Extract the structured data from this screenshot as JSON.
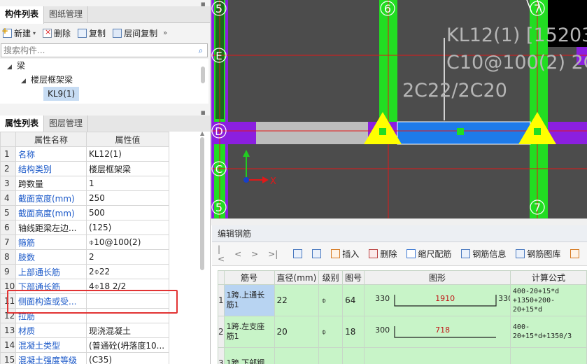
{
  "top_panel": {
    "tabs": [
      {
        "label": "构件列表"
      },
      {
        "label": "图纸管理"
      }
    ],
    "toolbar": {
      "new": "新建",
      "delete": "删除",
      "copy": "复制",
      "layer_copy": "层间复制"
    },
    "search_placeholder": "搜索构件...",
    "tree": {
      "root": "梁",
      "child": "楼层框架梁",
      "item": "KL9(1)"
    }
  },
  "prop_panel": {
    "tabs": [
      {
        "label": "属性列表"
      },
      {
        "label": "图层管理"
      }
    ],
    "headers": {
      "name": "属性名称",
      "value": "属性值"
    },
    "rows": [
      {
        "n": "1",
        "name": "名称",
        "value": "KL12(1)",
        "color": "blue"
      },
      {
        "n": "2",
        "name": "结构类别",
        "value": "楼层框架梁",
        "color": "blue"
      },
      {
        "n": "3",
        "name": "跨数量",
        "value": "1",
        "color": "dark"
      },
      {
        "n": "4",
        "name": "截面宽度(mm)",
        "value": "250",
        "color": "blue"
      },
      {
        "n": "5",
        "name": "截面高度(mm)",
        "value": "500",
        "color": "blue"
      },
      {
        "n": "6",
        "name": "轴线距梁左边...",
        "value": "(125)",
        "color": "dark"
      },
      {
        "n": "7",
        "name": "箍筋",
        "value": "⌽10@100(2)",
        "color": "blue"
      },
      {
        "n": "8",
        "name": "肢数",
        "value": "2",
        "color": "blue"
      },
      {
        "n": "9",
        "name": "上部通长筋",
        "value": "2⌽22",
        "color": "blue"
      },
      {
        "n": "10",
        "name": "下部通长筋",
        "value": "4⌽18 2/2",
        "color": "blue"
      },
      {
        "n": "11",
        "name": "侧面构造或受...",
        "value": "",
        "color": "blue"
      },
      {
        "n": "12",
        "name": "拉筋",
        "value": "",
        "color": "blue"
      },
      {
        "n": "13",
        "name": "材质",
        "value": "现浇混凝土",
        "color": "blue"
      },
      {
        "n": "14",
        "name": "混凝土类型",
        "value": "(普通砼(坍落度10...",
        "color": "blue"
      },
      {
        "n": "15",
        "name": "混凝土强度等级",
        "value": "(C35)",
        "color": "blue"
      }
    ]
  },
  "canvas": {
    "axes": {
      "a5": "5",
      "a6": "6",
      "a7": "7",
      "aE": "E",
      "aD": "D",
      "aC": "C",
      "a5b": "5",
      "a7b": "7"
    },
    "annotation": {
      "line1": "KL12(1) [15203",
      "line2": "C10@100(2) 2C",
      "line3": "2C22/2C20"
    },
    "ucs_x": "X",
    "colors": {
      "background": "#4c4c4c",
      "column": "#22dd22",
      "wall": "#8b1fe0",
      "beam": "#1e7bea",
      "axis": "#e21818",
      "support": "#ffff00",
      "annotation": "#b5b5b5"
    }
  },
  "rebar_panel": {
    "title": "编辑钢筋",
    "toolbar": {
      "nav_first": "|<",
      "nav_prev": "<",
      "nav_next": ">",
      "nav_last": ">|",
      "insert": "插入",
      "delete": "删除",
      "scale": "缩尺配筋",
      "info": "钢筋信息",
      "library": "钢筋图库"
    },
    "headers": {
      "num": "筋号",
      "dia": "直径(mm)",
      "grade": "级别",
      "fig_no": "图号",
      "figure": "图形",
      "formula": "计算公式"
    },
    "rows": [
      {
        "n": "1",
        "name": "1跨.上通长筋1",
        "dia": "22",
        "grade": "⌽",
        "fig": "64",
        "left": "330",
        "mid": "1910",
        "right": "330",
        "formula": "400-20+15*d +1350+200-20+15*d"
      },
      {
        "n": "2",
        "name": "1跨.左支座筋1",
        "dia": "20",
        "grade": "⌽",
        "fig": "18",
        "left": "300",
        "mid": "718",
        "right": "",
        "formula": "400-20+15*d+1350/3"
      },
      {
        "n": "3",
        "name": "1跨.下部钢",
        "dia": "",
        "grade": "",
        "fig": "",
        "left": "",
        "mid": "",
        "right": "",
        "formula": ""
      }
    ]
  }
}
